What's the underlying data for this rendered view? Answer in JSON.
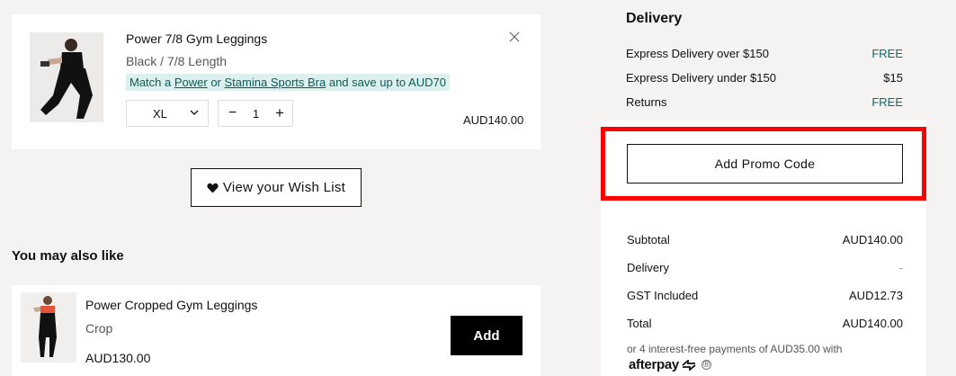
{
  "cart_item": {
    "title": "Power 7/8 Gym Leggings",
    "variant": "Black / 7/8 Length",
    "promo": {
      "prefix": "Match a ",
      "link1": "Power",
      "middle": " or ",
      "link2": "Stamina Sports Bra",
      "suffix": " and save up to AUD70"
    },
    "size": "XL",
    "quantity": "1",
    "minus": "−",
    "plus": "+",
    "price": "AUD140.00"
  },
  "wishlist_label": "View your Wish List",
  "recommendations": {
    "heading": "You may also like",
    "items": [
      {
        "title": "Power Cropped Gym Leggings",
        "variant": "Crop",
        "price": "AUD130.00",
        "add_label": "Add"
      }
    ]
  },
  "delivery": {
    "title": "Delivery",
    "rows": [
      {
        "label": "Express Delivery over $150",
        "value": "FREE"
      },
      {
        "label": "Express Delivery under $150",
        "value": "$15"
      },
      {
        "label": "Returns",
        "value": "FREE"
      }
    ]
  },
  "promo_code_label": "Add Promo Code",
  "summary": {
    "rows": [
      {
        "label": "Subtotal",
        "value": "AUD140.00"
      },
      {
        "label": "Delivery",
        "value": "-"
      },
      {
        "label": "GST Included",
        "value": "AUD12.73"
      },
      {
        "label": "Total",
        "value": "AUD140.00"
      }
    ],
    "installments": "or 4 interest-free payments of AUD35.00 with",
    "afterpay_logo": "afterpay",
    "afterpay_info": "®"
  },
  "colors": {
    "accent_teal": "#0d6b69",
    "promo_bg": "#dcf1ef",
    "highlight_red": "#ff0000"
  }
}
